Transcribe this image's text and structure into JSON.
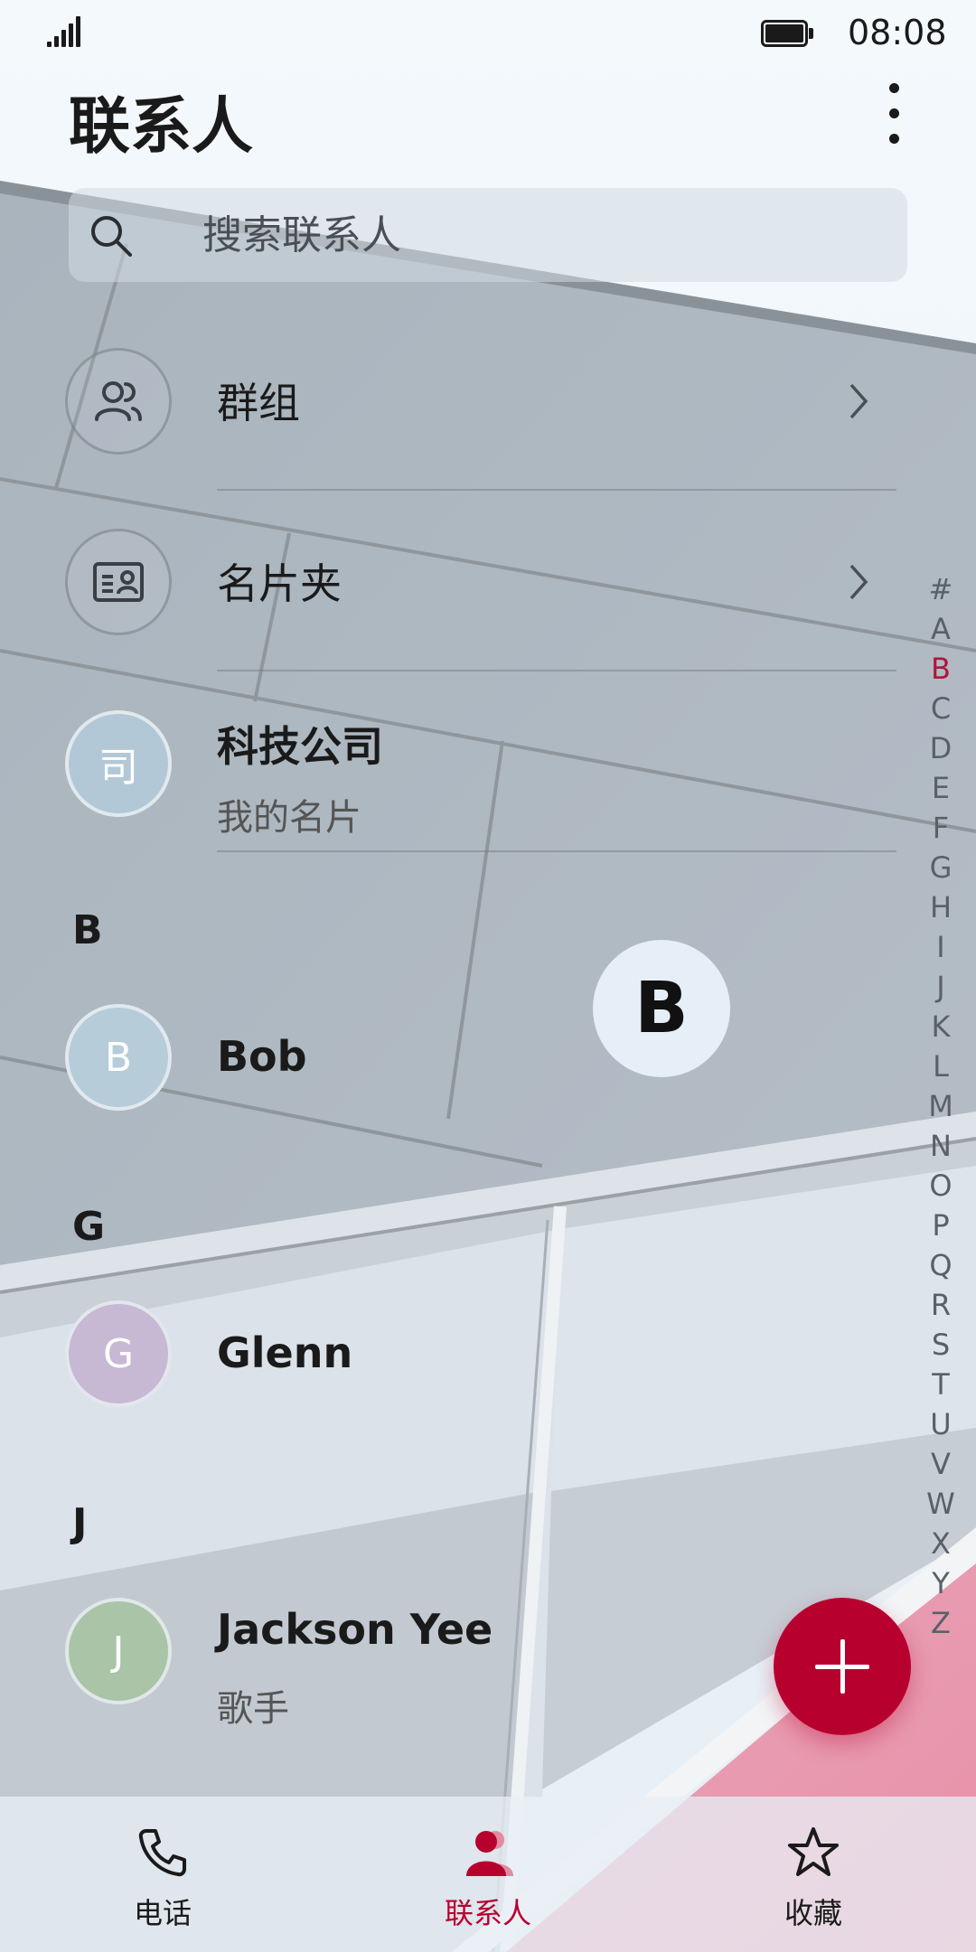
{
  "status_bar": {
    "time": "08:08"
  },
  "header": {
    "title": "联系人"
  },
  "search": {
    "placeholder": "搜索联系人"
  },
  "entries": [
    {
      "title": "群组"
    },
    {
      "title": "名片夹"
    }
  ],
  "my_card": {
    "avatar": "司",
    "name": "科技公司",
    "subtitle": "我的名片"
  },
  "sections": [
    {
      "letter": "B",
      "contacts": [
        {
          "avatar": "B",
          "name": "Bob"
        }
      ]
    },
    {
      "letter": "G",
      "contacts": [
        {
          "avatar": "G",
          "name": "Glenn"
        }
      ]
    },
    {
      "letter": "J",
      "contacts": [
        {
          "avatar": "J",
          "name": "Jackson Yee",
          "subtitle": "歌手"
        }
      ]
    }
  ],
  "letter_bubble": "B",
  "alphabet_index": {
    "letters": [
      "#",
      "A",
      "B",
      "C",
      "D",
      "E",
      "F",
      "G",
      "H",
      "I",
      "J",
      "K",
      "L",
      "M",
      "N",
      "O",
      "P",
      "Q",
      "R",
      "S",
      "T",
      "U",
      "V",
      "W",
      "X",
      "Y",
      "Z"
    ],
    "active": "B"
  },
  "bottom_nav": [
    {
      "label": "电话",
      "icon": "phone-icon",
      "active": false
    },
    {
      "label": "联系人",
      "icon": "contacts-icon",
      "active": true
    },
    {
      "label": "收藏",
      "icon": "star-icon",
      "active": false
    }
  ],
  "colors": {
    "accent": "#b8002f",
    "avatar_my_card": "#b3c8d6",
    "avatar_b": "#b6ccd9",
    "avatar_g": "#c7b8d4",
    "avatar_j": "#a9c4a6"
  }
}
